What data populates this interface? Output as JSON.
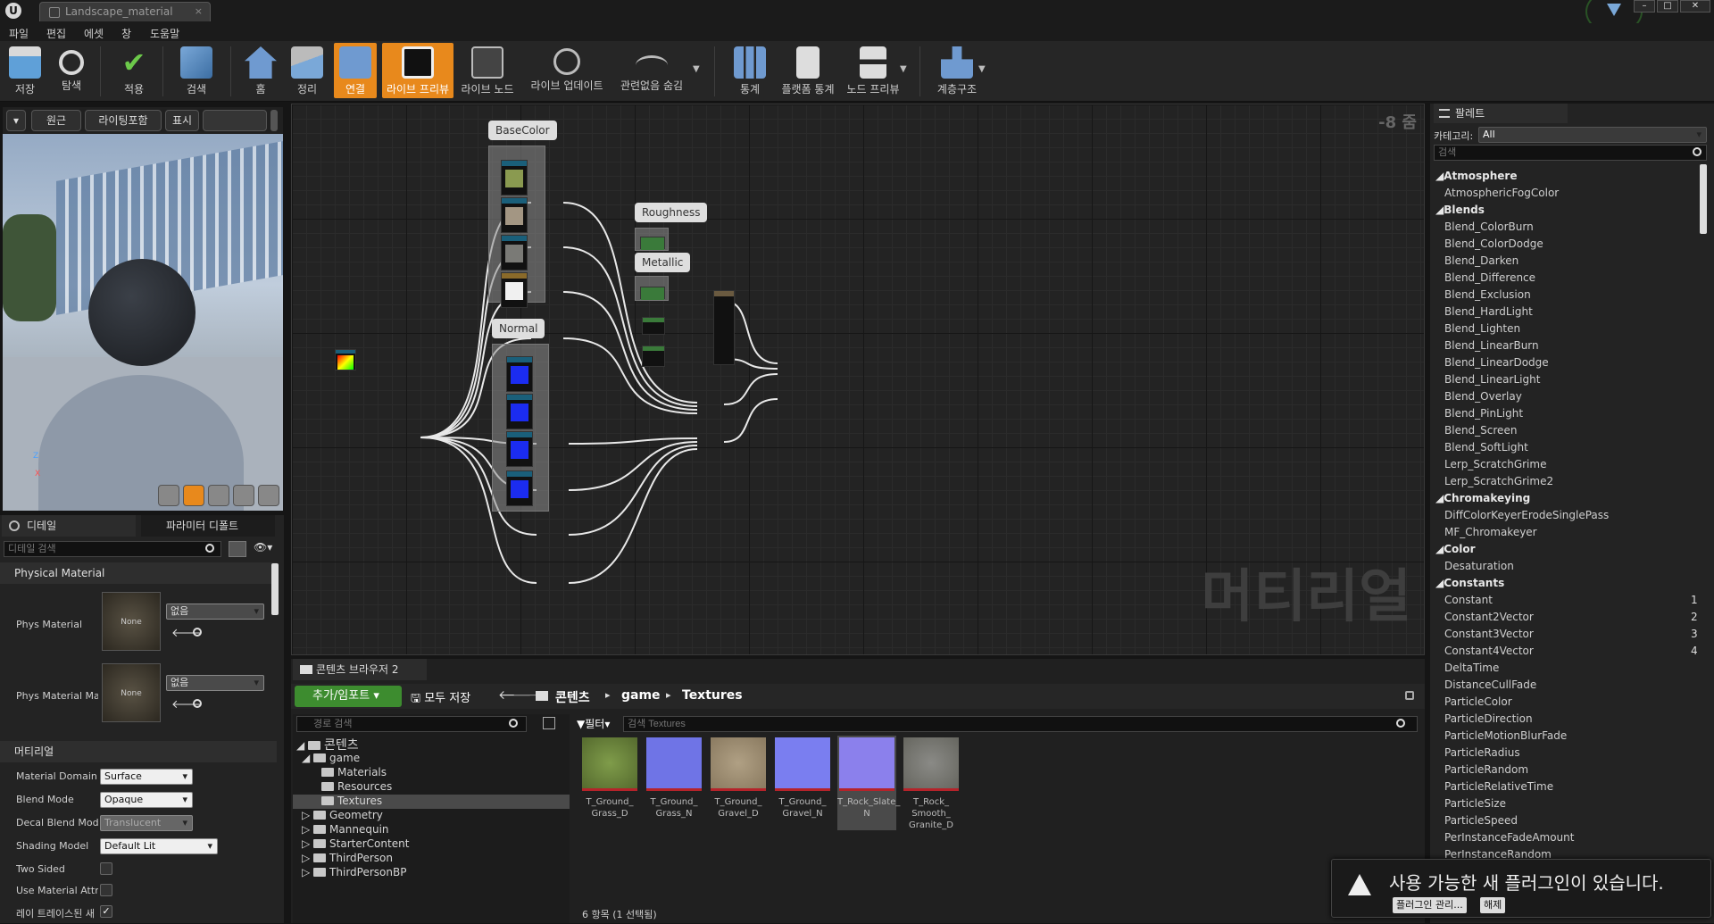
{
  "titlebar": {
    "tab_title": "Landscape_material",
    "close": "×",
    "logo": "U"
  },
  "menu": [
    "파일",
    "편집",
    "에셋",
    "창",
    "도움말"
  ],
  "toolbar": [
    {
      "label": "저장",
      "icon": "save-icon"
    },
    {
      "label": "탐색",
      "icon": "browse-icon"
    },
    {
      "label": "적용",
      "icon": "apply-icon"
    },
    {
      "label": "검색",
      "icon": "search-icon"
    },
    {
      "label": "홈",
      "icon": "home-icon"
    },
    {
      "label": "정리",
      "icon": "clean-icon"
    },
    {
      "label": "연결",
      "icon": "connectors-icon"
    },
    {
      "label": "라이브 프리뷰",
      "icon": "live-preview-icon"
    },
    {
      "label": "라이브 노드",
      "icon": "live-nodes-icon"
    },
    {
      "label": "라이브 업데이트",
      "icon": "live-update-icon"
    },
    {
      "label": "관련없음 숨김",
      "icon": "hide-unrelated-icon"
    },
    {
      "label": "통계",
      "icon": "stats-icon"
    },
    {
      "label": "플랫폼 통계",
      "icon": "platform-stats-icon"
    },
    {
      "label": "노드 프리뷰",
      "icon": "node-preview-icon"
    },
    {
      "label": "계층구조",
      "icon": "hierarchy-icon"
    }
  ],
  "viewport": {
    "btn_perspective": "원근",
    "btn_lit": "라이팅포함",
    "btn_show": "표시",
    "axis_z": "Z",
    "axis_x": "X"
  },
  "details": {
    "tab_details": "디테일",
    "tab_params": "파라미터 디폴트",
    "search_placeholder": "디테일 검색",
    "section_physical": "Physical Material",
    "phys_label": "Phys Material",
    "phys_mask_label": "Phys Material Ma",
    "none": "None",
    "none_combo": "없음",
    "section_material": "머티리얼",
    "props": [
      {
        "key": "Material Domain",
        "value": "Surface"
      },
      {
        "key": "Blend Mode",
        "value": "Opaque"
      },
      {
        "key": "Decal Blend Mode",
        "value": "Translucent"
      },
      {
        "key": "Shading Model",
        "value": "Default Lit"
      },
      {
        "key": "Two Sided",
        "value": ""
      },
      {
        "key": "Use Material Attri",
        "value": ""
      },
      {
        "key": "레이 트레이스된 새",
        "value": ""
      }
    ]
  },
  "graph": {
    "zoom": "-8 줌",
    "watermark": "머티리얼",
    "comments": {
      "base": "BaseColor",
      "normal": "Normal",
      "rough": "Roughness",
      "metal": "Metallic"
    }
  },
  "content_browser": {
    "tab": "콘텐츠 브라우저 2",
    "add_import": "추가/임포트",
    "save_all": "모두 저장",
    "crumbs": [
      "콘텐츠",
      "game",
      "Textures"
    ],
    "path_search_placeholder": "경로 검색",
    "filter": "필터",
    "asset_search_placeholder": "검색 Textures",
    "tree": [
      {
        "label": "콘텐츠",
        "level": 0
      },
      {
        "label": "game",
        "level": 1
      },
      {
        "label": "Materials",
        "level": 2
      },
      {
        "label": "Resources",
        "level": 2
      },
      {
        "label": "Textures",
        "level": 2,
        "selected": true
      },
      {
        "label": "Geometry",
        "level": 1
      },
      {
        "label": "Mannequin",
        "level": 1
      },
      {
        "label": "StarterContent",
        "level": 1
      },
      {
        "label": "ThirdPerson",
        "level": 1
      },
      {
        "label": "ThirdPersonBP",
        "level": 1
      }
    ],
    "assets": [
      {
        "name": "T_Ground_\nGrass_D",
        "color": "#6a8a3a"
      },
      {
        "name": "T_Ground_\nGrass_N",
        "color": "#6f74e6"
      },
      {
        "name": "T_Ground_\nGravel_D",
        "color": "#9a8a70"
      },
      {
        "name": "T_Ground_\nGravel_N",
        "color": "#7a7ef0"
      },
      {
        "name": "T_Rock_Slate_\nN",
        "color": "#8b80ec"
      },
      {
        "name": "T_Rock_\nSmooth_\nGranite_D",
        "color": "#7a7a76"
      }
    ],
    "status": "6 항목 (1 선택됨)"
  },
  "palette": {
    "title": "팔레트",
    "category_label": "카테고리:",
    "category_value": "All",
    "search_placeholder": "검색",
    "items": [
      {
        "t": "cat",
        "label": "Atmosphere"
      },
      {
        "t": "item",
        "label": "AtmosphericFogColor"
      },
      {
        "t": "cat",
        "label": "Blends"
      },
      {
        "t": "item",
        "label": "Blend_ColorBurn"
      },
      {
        "t": "item",
        "label": "Blend_ColorDodge"
      },
      {
        "t": "item",
        "label": "Blend_Darken"
      },
      {
        "t": "item",
        "label": "Blend_Difference"
      },
      {
        "t": "item",
        "label": "Blend_Exclusion"
      },
      {
        "t": "item",
        "label": "Blend_HardLight"
      },
      {
        "t": "item",
        "label": "Blend_Lighten"
      },
      {
        "t": "item",
        "label": "Blend_LinearBurn"
      },
      {
        "t": "item",
        "label": "Blend_LinearDodge"
      },
      {
        "t": "item",
        "label": "Blend_LinearLight"
      },
      {
        "t": "item",
        "label": "Blend_Overlay"
      },
      {
        "t": "item",
        "label": "Blend_PinLight"
      },
      {
        "t": "item",
        "label": "Blend_Screen"
      },
      {
        "t": "item",
        "label": "Blend_SoftLight"
      },
      {
        "t": "item",
        "label": "Lerp_ScratchGrime"
      },
      {
        "t": "item",
        "label": "Lerp_ScratchGrime2"
      },
      {
        "t": "cat",
        "label": "Chromakeying"
      },
      {
        "t": "item",
        "label": "DiffColorKeyerErodeSinglePass"
      },
      {
        "t": "item",
        "label": "MF_Chromakeyer"
      },
      {
        "t": "cat",
        "label": "Color"
      },
      {
        "t": "item",
        "label": "Desaturation"
      },
      {
        "t": "cat",
        "label": "Constants"
      },
      {
        "t": "item",
        "label": "Constant",
        "hot": "1"
      },
      {
        "t": "item",
        "label": "Constant2Vector",
        "hot": "2"
      },
      {
        "t": "item",
        "label": "Constant3Vector",
        "hot": "3"
      },
      {
        "t": "item",
        "label": "Constant4Vector",
        "hot": "4"
      },
      {
        "t": "item",
        "label": "DeltaTime"
      },
      {
        "t": "item",
        "label": "DistanceCullFade"
      },
      {
        "t": "item",
        "label": "ParticleColor"
      },
      {
        "t": "item",
        "label": "ParticleDirection"
      },
      {
        "t": "item",
        "label": "ParticleMotionBlurFade"
      },
      {
        "t": "item",
        "label": "ParticleRadius"
      },
      {
        "t": "item",
        "label": "ParticleRandom"
      },
      {
        "t": "item",
        "label": "ParticleRelativeTime"
      },
      {
        "t": "item",
        "label": "ParticleSize"
      },
      {
        "t": "item",
        "label": "ParticleSpeed"
      },
      {
        "t": "item",
        "label": "PerInstanceFadeAmount"
      },
      {
        "t": "item",
        "label": "PerInstanceRandom"
      }
    ]
  },
  "notification": {
    "text": "사용 가능한 새 플러그인이 있습니다.",
    "manage": "플러그인 관리...",
    "dismiss": "해제"
  },
  "colors": {
    "accent": "#e8891c",
    "add_green": "#3d8c2f",
    "red_bar": "#b5232a",
    "node_header": "#1a5f7a"
  }
}
